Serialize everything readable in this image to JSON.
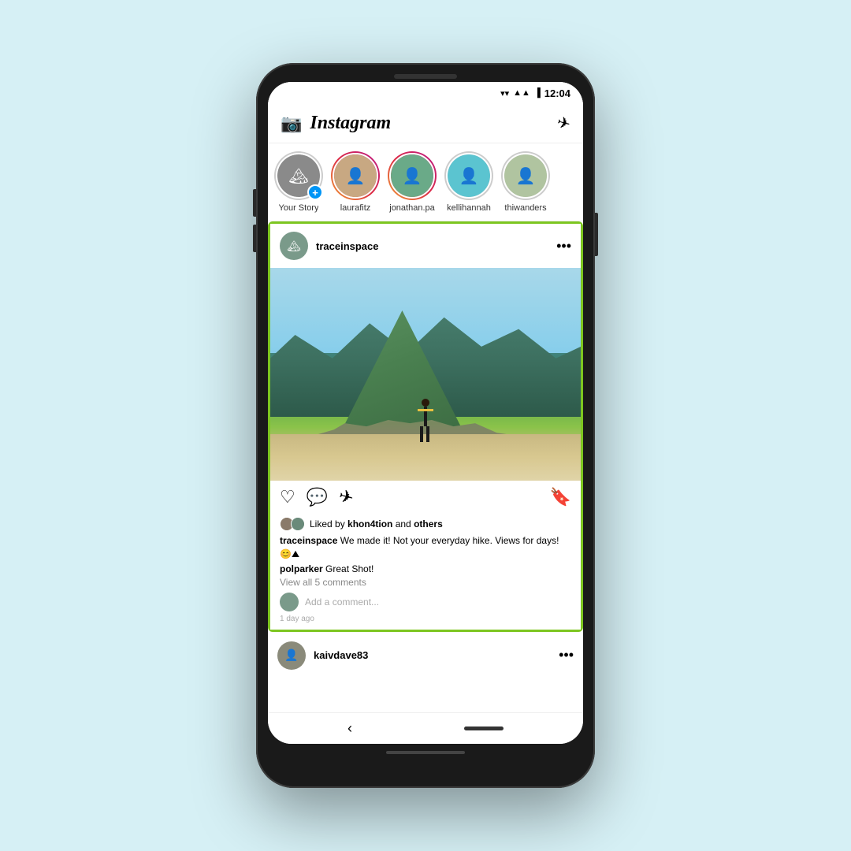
{
  "phone": {
    "status_bar": {
      "time": "12:04",
      "signal": "▲",
      "wifi": "▲",
      "battery": "🔋"
    }
  },
  "header": {
    "logo": "Instagram",
    "camera_icon": "📷",
    "send_icon": "✈"
  },
  "stories": {
    "items": [
      {
        "id": "your-story",
        "label": "Your Story",
        "has_add": true,
        "ring_type": "own",
        "avatar_color": "#8a9a8a",
        "avatar_emoji": "🏔"
      },
      {
        "id": "laurafitz",
        "label": "laurafitz",
        "has_add": false,
        "ring_type": "gradient",
        "avatar_color": "#c8a882",
        "avatar_emoji": "👤"
      },
      {
        "id": "jonathan-pa",
        "label": "jonathan.pa",
        "has_add": false,
        "ring_type": "gradient",
        "avatar_color": "#6aaa88",
        "avatar_emoji": "👤"
      },
      {
        "id": "kellihannah",
        "label": "kellihannah",
        "has_add": false,
        "ring_type": "seen",
        "avatar_color": "#5bc4d0",
        "avatar_emoji": "👤"
      },
      {
        "id": "thiwanders",
        "label": "thiwanders",
        "has_add": false,
        "ring_type": "seen",
        "avatar_color": "#b0c4a0",
        "avatar_emoji": "👤"
      }
    ]
  },
  "posts": [
    {
      "id": "post-1",
      "username": "traceinspace",
      "avatar_color": "#7a9a8a",
      "highlighted": true,
      "liked_by_bold": "khon4tion",
      "liked_by_suffix": " and ",
      "liked_by_others": "others",
      "caption_user": "traceinspace",
      "caption_text": " We made it! Not your everyday hike. Views for days! 😊⛰",
      "comment_user": "polparker",
      "comment_text": " Great Shot!",
      "view_comments": "View all 5 comments",
      "add_comment_placeholder": "Add a comment...",
      "timestamp": "1 day ago"
    },
    {
      "id": "post-2",
      "username": "kaivdave83",
      "avatar_color": "#8a8a7a",
      "highlighted": false
    }
  ]
}
